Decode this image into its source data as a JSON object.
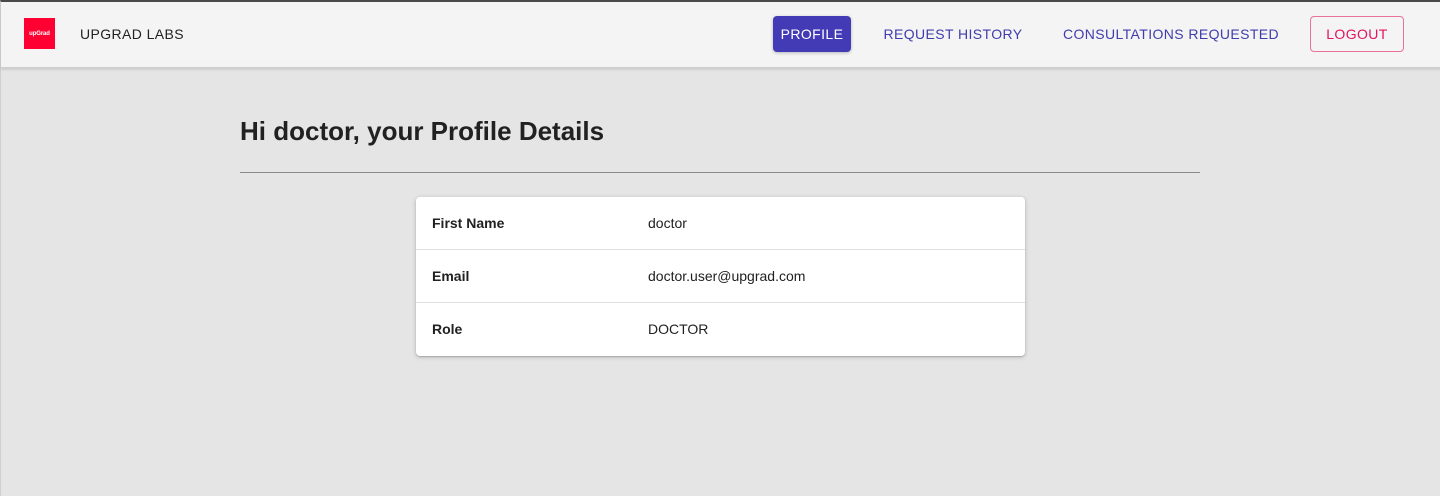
{
  "header": {
    "logo_text": "upGrad",
    "app_title": "UPGRAD LABS",
    "nav": {
      "profile": "PROFILE",
      "request_history": "REQUEST HISTORY",
      "consultations_requested": "CONSULTATIONS REQUESTED",
      "logout": "LOGOUT"
    },
    "active_tab": "PROFILE"
  },
  "main": {
    "title": "Hi doctor, your Profile Details",
    "profile_rows": [
      {
        "label": "First Name",
        "value": "doctor"
      },
      {
        "label": "Email",
        "value": "doctor.user@upgrad.com"
      },
      {
        "label": "Role",
        "value": "DOCTOR"
      }
    ]
  },
  "colors": {
    "primary": "#433ab6",
    "logout_accent": "#e0145f",
    "brand_red": "#ff0033",
    "background": "#e5e5e5",
    "header_background": "#f4f4f4"
  }
}
